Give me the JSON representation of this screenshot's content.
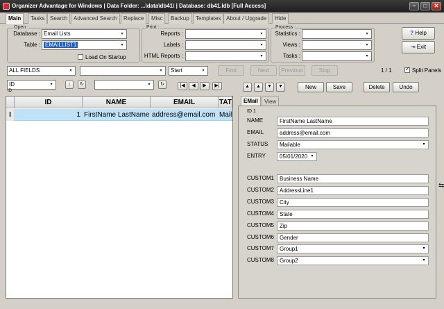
{
  "window": {
    "title": "Organizer Advantage for Windows | Data Folder: ...\\data\\db41\\ | Database: db41.ldb [Full Access]",
    "min": "–",
    "max": "□",
    "close": "✕"
  },
  "tabs": [
    "Main",
    "Tasks",
    "Search",
    "Advanced Search",
    "Replace",
    "Misc",
    "Backup",
    "Templates",
    "About / Upgrade",
    "Hide"
  ],
  "open": {
    "group": "Open :",
    "database_label": "Database :",
    "database_value": "Email Lists",
    "table_label": "Table :",
    "table_value": "EMAILLIST1",
    "load_on_startup": "Load On Startup"
  },
  "print": {
    "group": "Print :",
    "reports": "Reports :",
    "labels": "Labels :",
    "html_reports": "HTML Reports :"
  },
  "process": {
    "group": "Process :",
    "statistics": "Statistics :",
    "views": "Views :",
    "tasks": "Tasks :"
  },
  "help_button": "Help",
  "exit_button": "Exit",
  "search": {
    "field": "ALL FIELDS",
    "mode": "Start",
    "find": "Find",
    "next": "Next",
    "previous": "Previous",
    "stop": "Stop",
    "count": "1 / 1",
    "split_panels": "Split Panels"
  },
  "sort": {
    "field": "ID",
    "sublabel": "ID",
    "up": "↕",
    "refresh": "↻"
  },
  "nav": {
    "first": "|◀",
    "prev": "◀",
    "next": "▶",
    "last": "▶|"
  },
  "grid": {
    "columns": [
      "ID",
      "NAME",
      "EMAIL",
      "TATU"
    ],
    "rows": [
      {
        "marker": "I",
        "id": "1",
        "name": "FirstName LastName",
        "email": "address@email.com",
        "status": "Mailab"
      }
    ]
  },
  "record_buttons": {
    "up_top": "▲",
    "up": "▲",
    "down": "▼",
    "down_bottom": "▼",
    "new": "New",
    "save": "Save",
    "delete": "Delete",
    "undo": "Undo"
  },
  "detail_tabs": [
    "EMail",
    "View"
  ],
  "detail": {
    "id_label": "ID 1",
    "fields": [
      {
        "label": "NAME",
        "value": "FirstName LastName"
      },
      {
        "label": "EMAIL",
        "value": "address@email.com"
      },
      {
        "label": "STATUS",
        "value": "Mailable"
      },
      {
        "label": "ENTRY",
        "value": "05/01/2020"
      }
    ],
    "customs": [
      {
        "label": "CUSTOM1",
        "value": "Business Name"
      },
      {
        "label": "CUSTOM2",
        "value": "AddressLine1"
      },
      {
        "label": "CUSTOM3",
        "value": "City"
      },
      {
        "label": "CUSTOM4",
        "value": "State"
      },
      {
        "label": "CUSTOM5",
        "value": "Zip"
      },
      {
        "label": "CUSTOM6",
        "value": "Gender"
      },
      {
        "label": "CUSTOM7",
        "value": "Group1"
      },
      {
        "label": "CUSTOM8",
        "value": "Group2"
      }
    ]
  },
  "icons": {
    "dropdown": "▾"
  }
}
